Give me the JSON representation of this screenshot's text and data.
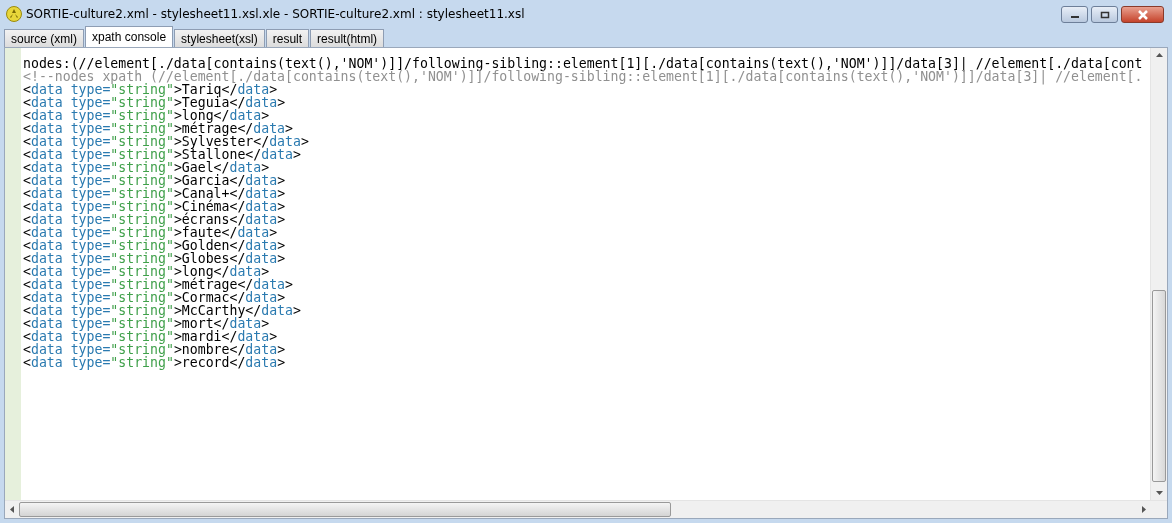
{
  "window": {
    "title": "SORTIE-culture2.xml - stylesheet11.xsl.xle - SORTIE-culture2.xml : stylesheet11.xsl"
  },
  "tabs": [
    {
      "label": "source (xml)",
      "selected": false
    },
    {
      "label": "xpath console",
      "selected": true
    },
    {
      "label": "stylesheet(xsl)",
      "selected": false
    },
    {
      "label": "result",
      "selected": false
    },
    {
      "label": "result(html)",
      "selected": false
    }
  ],
  "editor": {
    "query": "nodes:(//element[./data[contains(text(),'NOM')]]/following-sibling::element[1][./data[contains(text(),'NOM')]]/data[3]| //element[./data[cont",
    "comment": "<!--nodes xpath (//element[./data[contains(text(),'NOM')]]/following-sibling::element[1][./data[contains(text(),'NOM')]]/data[3]| //element[.",
    "lines": [
      {
        "open": "<",
        "tag": "data",
        "attr": " type=",
        "str": "\"string\"",
        "text": ">Tariq</",
        "ctag": "data",
        "gt": ">"
      },
      {
        "open": "<",
        "tag": "data",
        "attr": " type=",
        "str": "\"string\"",
        "text": ">Teguia</",
        "ctag": "data",
        "gt": ">"
      },
      {
        "open": "<",
        "tag": "data",
        "attr": " type=",
        "str": "\"string\"",
        "text": ">long</",
        "ctag": "data",
        "gt": ">"
      },
      {
        "open": "<",
        "tag": "data",
        "attr": " type=",
        "str": "\"string\"",
        "text": ">métrage</",
        "ctag": "data",
        "gt": ">"
      },
      {
        "open": "<",
        "tag": "data",
        "attr": " type=",
        "str": "\"string\"",
        "text": ">Sylvester</",
        "ctag": "data",
        "gt": ">"
      },
      {
        "open": "<",
        "tag": "data",
        "attr": " type=",
        "str": "\"string\"",
        "text": ">Stallone</",
        "ctag": "data",
        "gt": ">"
      },
      {
        "open": "<",
        "tag": "data",
        "attr": " type=",
        "str": "\"string\"",
        "text": ">Gael</",
        "ctag": "data",
        "gt": ">"
      },
      {
        "open": "<",
        "tag": "data",
        "attr": " type=",
        "str": "\"string\"",
        "text": ">Garcia</",
        "ctag": "data",
        "gt": ">"
      },
      {
        "open": "<",
        "tag": "data",
        "attr": " type=",
        "str": "\"string\"",
        "text": ">Canal+</",
        "ctag": "data",
        "gt": ">"
      },
      {
        "open": "<",
        "tag": "data",
        "attr": " type=",
        "str": "\"string\"",
        "text": ">Cinéma</",
        "ctag": "data",
        "gt": ">"
      },
      {
        "open": "<",
        "tag": "data",
        "attr": " type=",
        "str": "\"string\"",
        "text": ">écrans</",
        "ctag": "data",
        "gt": ">"
      },
      {
        "open": "<",
        "tag": "data",
        "attr": " type=",
        "str": "\"string\"",
        "text": ">faute</",
        "ctag": "data",
        "gt": ">"
      },
      {
        "open": "<",
        "tag": "data",
        "attr": " type=",
        "str": "\"string\"",
        "text": ">Golden</",
        "ctag": "data",
        "gt": ">"
      },
      {
        "open": "<",
        "tag": "data",
        "attr": " type=",
        "str": "\"string\"",
        "text": ">Globes</",
        "ctag": "data",
        "gt": ">"
      },
      {
        "open": "<",
        "tag": "data",
        "attr": " type=",
        "str": "\"string\"",
        "text": ">long</",
        "ctag": "data",
        "gt": ">"
      },
      {
        "open": "<",
        "tag": "data",
        "attr": " type=",
        "str": "\"string\"",
        "text": ">métrage</",
        "ctag": "data",
        "gt": ">"
      },
      {
        "open": "<",
        "tag": "data",
        "attr": " type=",
        "str": "\"string\"",
        "text": ">Cormac</",
        "ctag": "data",
        "gt": ">"
      },
      {
        "open": "<",
        "tag": "data",
        "attr": " type=",
        "str": "\"string\"",
        "text": ">McCarthy</",
        "ctag": "data",
        "gt": ">"
      },
      {
        "open": "<",
        "tag": "data",
        "attr": " type=",
        "str": "\"string\"",
        "text": ">mort</",
        "ctag": "data",
        "gt": ">"
      },
      {
        "open": "<",
        "tag": "data",
        "attr": " type=",
        "str": "\"string\"",
        "text": ">mardi</",
        "ctag": "data",
        "gt": ">"
      },
      {
        "open": "<",
        "tag": "data",
        "attr": " type=",
        "str": "\"string\"",
        "text": ">nombre</",
        "ctag": "data",
        "gt": ">"
      },
      {
        "open": "<",
        "tag": "data",
        "attr": " type=",
        "str": "\"string\"",
        "text": ">record</",
        "ctag": "data",
        "gt": ">"
      }
    ]
  }
}
